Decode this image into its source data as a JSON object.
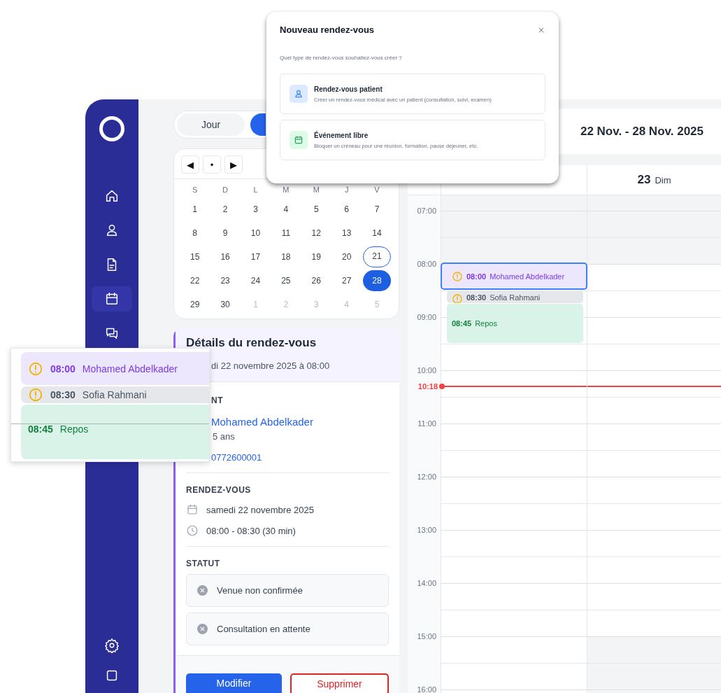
{
  "sidebar": {
    "items": [
      {
        "selected": false
      },
      {
        "selected": false
      },
      {
        "selected": false
      },
      {
        "selected": true
      },
      {
        "selected": false
      }
    ],
    "bottom_items": [
      {
        "selected": false
      },
      {
        "selected": false
      }
    ]
  },
  "view_tabs": [
    {
      "label": "Jour",
      "selected": false
    },
    {
      "selected": true
    }
  ],
  "mini_calendar": {
    "nav": [
      "◀",
      "•",
      "▶"
    ],
    "weekdays": [
      "S",
      "D",
      "L",
      "M",
      "M",
      "J",
      "V"
    ],
    "days": [
      {
        "label": "1",
        "muted": false,
        "today": false,
        "selected": false
      },
      {
        "label": "2",
        "muted": false,
        "today": false,
        "selected": false
      },
      {
        "label": "3",
        "muted": false,
        "today": false,
        "selected": false
      },
      {
        "label": "4",
        "muted": false,
        "today": false,
        "selected": false
      },
      {
        "label": "5",
        "muted": false,
        "today": false,
        "selected": false
      },
      {
        "label": "6",
        "muted": false,
        "today": false,
        "selected": false
      },
      {
        "label": "7",
        "muted": false,
        "today": false,
        "selected": false
      },
      {
        "label": "8",
        "muted": false,
        "today": false,
        "selected": false
      },
      {
        "label": "9",
        "muted": false,
        "today": false,
        "selected": false
      },
      {
        "label": "10",
        "muted": false,
        "today": false,
        "selected": false
      },
      {
        "label": "11",
        "muted": false,
        "today": false,
        "selected": false
      },
      {
        "label": "12",
        "muted": false,
        "today": false,
        "selected": false
      },
      {
        "label": "13",
        "muted": false,
        "today": false,
        "selected": false
      },
      {
        "label": "14",
        "muted": false,
        "today": false,
        "selected": false
      },
      {
        "label": "15",
        "muted": false,
        "today": false,
        "selected": false
      },
      {
        "label": "16",
        "muted": false,
        "today": false,
        "selected": false
      },
      {
        "label": "17",
        "muted": false,
        "today": false,
        "selected": false
      },
      {
        "label": "18",
        "muted": false,
        "today": false,
        "selected": false
      },
      {
        "label": "19",
        "muted": false,
        "today": false,
        "selected": false
      },
      {
        "label": "20",
        "muted": false,
        "today": false,
        "selected": false
      },
      {
        "label": "21",
        "muted": false,
        "today": true,
        "selected": false
      },
      {
        "label": "22",
        "muted": false,
        "today": false,
        "selected": false
      },
      {
        "label": "23",
        "muted": false,
        "today": false,
        "selected": false
      },
      {
        "label": "24",
        "muted": false,
        "today": false,
        "selected": false
      },
      {
        "label": "25",
        "muted": false,
        "today": false,
        "selected": false
      },
      {
        "label": "26",
        "muted": false,
        "today": false,
        "selected": false
      },
      {
        "label": "27",
        "muted": false,
        "today": false,
        "selected": false
      },
      {
        "label": "28",
        "muted": false,
        "today": false,
        "selected": true
      },
      {
        "label": "29",
        "muted": false,
        "today": false,
        "selected": false
      },
      {
        "label": "30",
        "muted": false,
        "today": false,
        "selected": false
      },
      {
        "label": "1",
        "muted": true,
        "today": false,
        "selected": false
      },
      {
        "label": "2",
        "muted": true,
        "today": false,
        "selected": false
      },
      {
        "label": "3",
        "muted": true,
        "today": false,
        "selected": false
      },
      {
        "label": "4",
        "muted": true,
        "today": false,
        "selected": false
      },
      {
        "label": "5",
        "muted": true,
        "today": false,
        "selected": false
      }
    ]
  },
  "details": {
    "title": "Détails du rendez-vous",
    "subtitle": "di 22 novembre 2025 à 08:00",
    "patient_label": "NT",
    "patient_name": "Mohamed Abdelkader",
    "patient_age": "5 ans",
    "patient_phone": "0772600001",
    "appointment_label": "RENDEZ-VOUS",
    "appointment_date": "samedi 22 novembre 2025",
    "appointment_time": "08:00 - 08:30 (30 min)",
    "status_label": "STATUT",
    "statuses": [
      "Venue non confirmée",
      "Consultation en attente"
    ],
    "buttons": [
      {
        "label": "Modifier",
        "kind": "primary"
      },
      {
        "label": "Supprimer",
        "kind": "danger"
      }
    ]
  },
  "week": {
    "title": "22 Nov. - 28 Nov. 2025",
    "hours": [
      "07:00",
      "08:00",
      "09:00",
      "10:00",
      "11:00",
      "12:00",
      "13:00",
      "14:00",
      "15:00",
      "16:00"
    ],
    "now": "10:18",
    "days": [
      {
        "events": [
          {
            "time": "08:00",
            "title": "Mohamed Abdelkader",
            "kind": "confirmed",
            "warning": true,
            "selected": true
          },
          {
            "time": "08:30",
            "title": "Sofia Rahmani",
            "kind": "pending",
            "warning": true,
            "selected": false
          },
          {
            "time": "08:45",
            "title": "Repos",
            "kind": "break",
            "warning": false,
            "selected": false
          }
        ]
      },
      {
        "number": "23",
        "name": "Dim"
      }
    ]
  },
  "modal": {
    "title": "Nouveau rendez-vous",
    "question": "Quel type de rendez-vous souhaitez-vous créer ?",
    "options": [
      {
        "kind": "patient",
        "title": "Rendez-vous patient",
        "description": "Créer un rendez-vous médical avec un patient (consultation, suivi, examen)"
      },
      {
        "kind": "event",
        "title": "Événement libre",
        "description": "Bloquer un créneau pour une réunion, formation, pause déjeuner, etc."
      }
    ]
  },
  "zoom_preview": {
    "events": [
      {
        "time": "08:00",
        "title": "Mohamed Abdelkader",
        "kind": "confirmed",
        "warning": true
      },
      {
        "time": "08:30",
        "title": "Sofia Rahmani",
        "kind": "pending",
        "warning": true
      },
      {
        "time": "08:45",
        "title": "Repos",
        "kind": "break",
        "warning": false
      }
    ]
  }
}
